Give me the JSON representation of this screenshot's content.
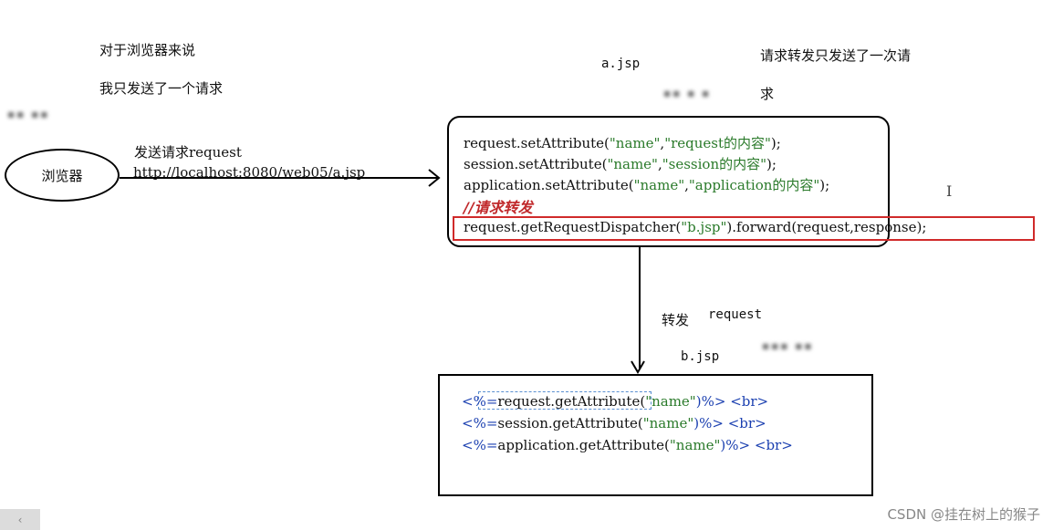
{
  "notes": {
    "browser_view_line1": "对于浏览器来说",
    "browser_view_line2": "我只发送了一个请求",
    "forward_note_line1": "请求转发只发送了一次请",
    "forward_note_line2": "求"
  },
  "browser": {
    "label": "浏览器"
  },
  "request_arrow": {
    "label": "发送请求request",
    "url": "http://localhost:8080/web05/a.jsp"
  },
  "page_a": {
    "title": "a.jsp",
    "lines": [
      {
        "pre": "request.setAttribute(",
        "s1": "\"name\"",
        "mid": ",",
        "s2": "\"request的内容\"",
        "post": ");"
      },
      {
        "pre": "session.setAttribute(",
        "s1": "\"name\"",
        "mid": ",",
        "s2": "\"session的内容\"",
        "post": ");"
      },
      {
        "pre": "application.setAttribute(",
        "s1": "\"name\"",
        "mid": ",",
        "s2": "\"application的内容\"",
        "post": ");"
      }
    ],
    "comment": "//请求转发",
    "dispatch": {
      "pre": "request.getRequestDispatcher(",
      "s1": "\"b.jsp\"",
      "post": ").forward(request,response);"
    }
  },
  "forward_arrow": {
    "label": "转发",
    "sublabel": "request"
  },
  "page_b": {
    "title": "b.jsp",
    "lines": [
      {
        "open": "<%=",
        "body": "request.getAttribute(",
        "s1": "\"name\"",
        "close": ")%>",
        "br": "<br>"
      },
      {
        "open": "<%=",
        "body": "session.getAttribute(",
        "s1": "\"name\"",
        "close": ")%>",
        "br": "<br>"
      },
      {
        "open": "<%=",
        "body": "application.getAttribute(",
        "s1": "\"name\"",
        "close": ")%>",
        "br": "<br>"
      }
    ]
  },
  "ui": {
    "cursor_icon": "text-cursor-icon",
    "scroll_left": "‹",
    "watermark": "CSDN @挂在树上的猴子",
    "colors": {
      "highlight_border": "#d02a2a",
      "comment": "#c0282a",
      "string": "#2a7a2a",
      "tag": "#1a3fb0"
    }
  }
}
